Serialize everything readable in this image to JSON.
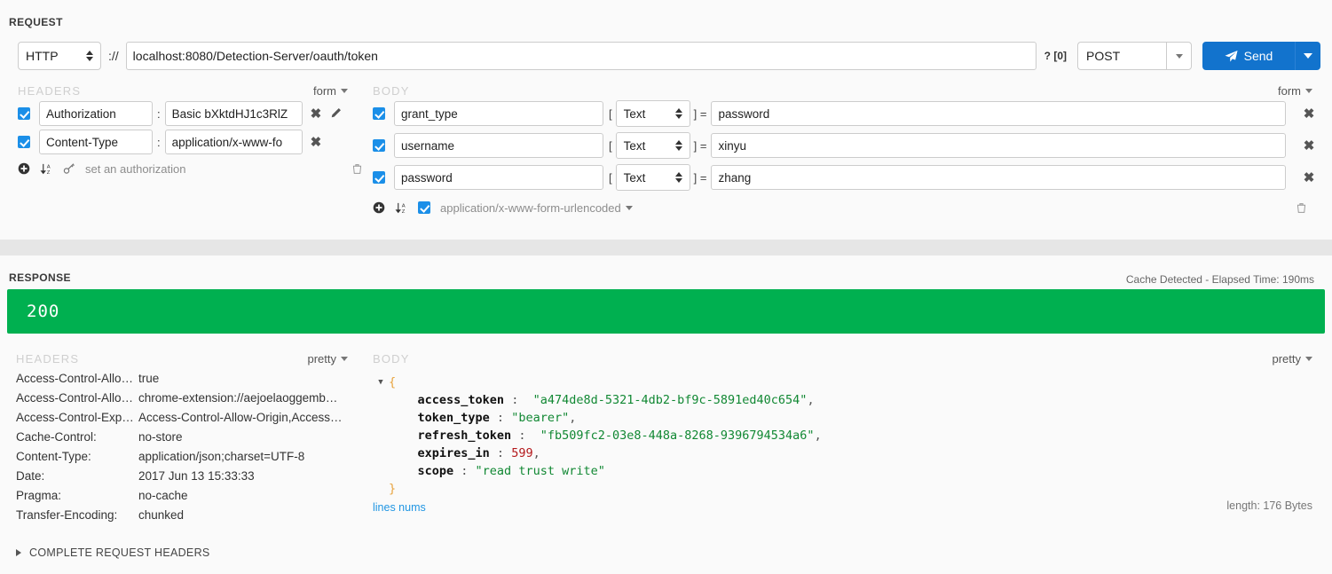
{
  "request": {
    "title": "REQUEST",
    "protocol": "HTTP",
    "protocol_separator": "://",
    "url": "localhost:8080/Detection-Server/oauth/token",
    "query_indicator": "? [0]",
    "method": "POST",
    "send_label": "Send",
    "headers": {
      "label": "HEADERS",
      "mode": "form",
      "rows": [
        {
          "checked": true,
          "key": "Authorization",
          "colon": ":",
          "value": "Basic bXktdHJ1c3RlZ",
          "has_edit": true
        },
        {
          "checked": true,
          "key": "Content-Type",
          "colon": ":",
          "value": "application/x-www-fo",
          "has_edit": false
        }
      ],
      "footer_link": "set an authorization"
    },
    "body": {
      "label": "BODY",
      "mode": "form",
      "rows": [
        {
          "checked": true,
          "key": "grant_type",
          "type": "Text",
          "value": "password"
        },
        {
          "checked": true,
          "key": "username",
          "type": "Text",
          "value": "xinyu"
        },
        {
          "checked": true,
          "key": "password",
          "type": "Text",
          "value": "zhang"
        }
      ],
      "content_type_checked": true,
      "content_type": "application/x-www-form-urlencoded"
    }
  },
  "response": {
    "title": "RESPONSE",
    "elapsed": "Cache Detected - Elapsed Time: 190ms",
    "status_code": "200",
    "status_color": "#00b050",
    "headers": {
      "label": "HEADERS",
      "mode": "pretty",
      "rows": [
        {
          "key": "Access-Control-Allow…",
          "value": "true"
        },
        {
          "key": "Access-Control-Allow…",
          "value": "chrome-extension://aejoelaoggemb…"
        },
        {
          "key": "Access-Control-Expo…",
          "value": "Access-Control-Allow-Origin,Access…"
        },
        {
          "key": "Cache-Control:",
          "value": "no-store"
        },
        {
          "key": "Content-Type:",
          "value": "application/json;charset=UTF-8"
        },
        {
          "key": "Date:",
          "value": "2017 Jun 13 15:33:33"
        },
        {
          "key": "Pragma:",
          "value": "no-cache"
        },
        {
          "key": "Transfer-Encoding:",
          "value": "chunked"
        }
      ]
    },
    "body": {
      "label": "BODY",
      "mode": "pretty",
      "open_brace": "{",
      "close_brace": "}",
      "fields": [
        {
          "key": "access_token",
          "sep": " :  ",
          "value": "\"a474de8d-5321-4db2-bf9c-5891ed40c654\"",
          "kind": "string",
          "comma": ","
        },
        {
          "key": "token_type",
          "sep": " : ",
          "value": "\"bearer\"",
          "kind": "string",
          "comma": ","
        },
        {
          "key": "refresh_token",
          "sep": " :  ",
          "value": "\"fb509fc2-03e8-448a-8268-9396794534a6\"",
          "kind": "string",
          "comma": ","
        },
        {
          "key": "expires_in",
          "sep": " : ",
          "value": "599",
          "kind": "number",
          "comma": ","
        },
        {
          "key": "scope",
          "sep": " : ",
          "value": "\"read trust write\"",
          "kind": "string",
          "comma": ""
        }
      ],
      "lines_nums_label": "lines nums",
      "length_label": "length: 176 Bytes"
    }
  },
  "footer": {
    "complete_request_headers": "COMPLETE REQUEST HEADERS"
  },
  "icons": {
    "send": "paper-plane-icon",
    "add": "circle-plus-icon",
    "sort": "sort-alpha-icon",
    "key": "key-icon",
    "pencil": "pencil-icon",
    "trash": "trash-icon",
    "close": "close-icon"
  }
}
